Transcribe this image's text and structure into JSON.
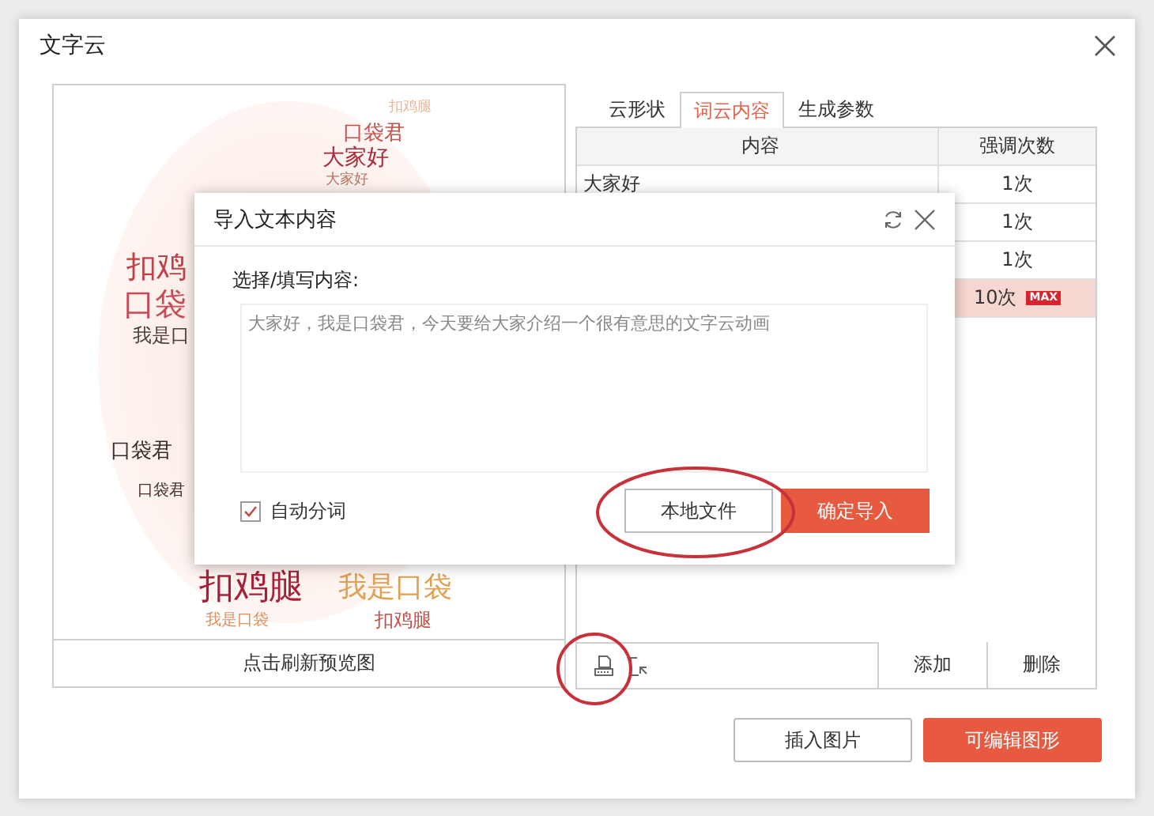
{
  "window": {
    "title": "文字云"
  },
  "preview": {
    "words": [
      {
        "text": "扣鸡腿",
        "color": "#e8b89a"
      },
      {
        "text": "口袋君",
        "color": "#c8504a"
      },
      {
        "text": "大家好",
        "color": "#a8283a"
      },
      {
        "text": "大家好",
        "color": "#b87060"
      },
      {
        "text": "扣鸡",
        "color": "#c0404a"
      },
      {
        "text": "口袋",
        "color": "#c84a58"
      },
      {
        "text": "我是口",
        "color": "#503a3a"
      },
      {
        "text": "口袋君",
        "color": "#3a2a2a"
      },
      {
        "text": "口袋君",
        "color": "#4a3030"
      },
      {
        "text": "扣鸡腿",
        "color": "#a82038"
      },
      {
        "text": "我是口袋",
        "color": "#e0a050"
      },
      {
        "text": "我是口袋",
        "color": "#e09060"
      },
      {
        "text": "扣鸡腿",
        "color": "#c0504a"
      }
    ],
    "refresh_button": "点击刷新预览图"
  },
  "tabs": [
    {
      "label": "云形状",
      "selected": false
    },
    {
      "label": "词云内容",
      "selected": true
    },
    {
      "label": "生成参数",
      "selected": false
    }
  ],
  "table": {
    "columns": [
      "内容",
      "强调次数"
    ],
    "rows": [
      {
        "content": "大家好",
        "count": "1次",
        "selected": false
      },
      {
        "count": "1次",
        "selected": false
      },
      {
        "count": "1次",
        "selected": false
      },
      {
        "count": "10次",
        "badge": "MAX",
        "selected": true
      }
    ]
  },
  "table_toolbar": {
    "buttons": [
      "添加",
      "删除"
    ]
  },
  "footer_buttons": [
    {
      "label": "插入图片",
      "primary": false
    },
    {
      "label": "可编辑图形",
      "primary": true
    }
  ],
  "dialog": {
    "title": "导入文本内容",
    "field_label": "选择/填写内容:",
    "text": "大家好，我是口袋君，今天要给大家介绍一个很有意思的文字云动画",
    "auto_segment": {
      "label": "自动分词",
      "checked": true
    },
    "buttons": [
      {
        "label": "本地文件",
        "primary": false
      },
      {
        "label": "确定导入",
        "primary": true
      }
    ]
  }
}
